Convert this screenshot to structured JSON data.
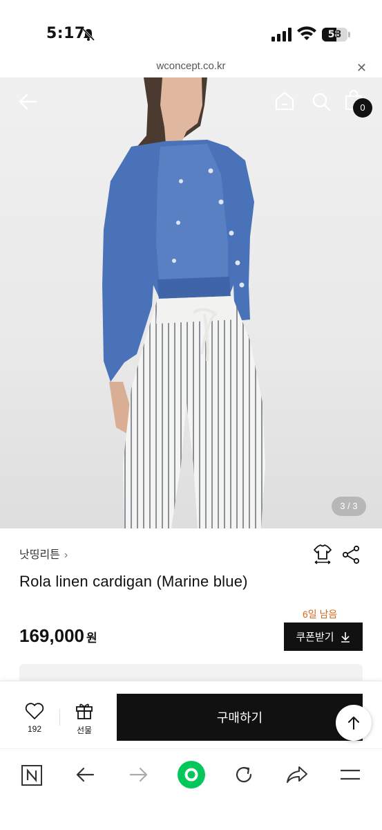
{
  "status_bar": {
    "time": "5:17",
    "battery_level": "58",
    "battery_fraction": 0.58
  },
  "browser": {
    "url": "wconcept.co.kr",
    "close_label": "✕"
  },
  "hero": {
    "cart_count": "0",
    "page_indicator": "3 / 3",
    "icons": [
      "back-arrow-icon",
      "home-icon",
      "search-icon",
      "shopping-bag-icon"
    ]
  },
  "product": {
    "brand": "낫띵리튼",
    "brand_chevron": "›",
    "name": "Rola linen cardigan (Marine blue)",
    "days_left": "6일 남음",
    "price": "169,000",
    "price_unit": "원",
    "coupon_label": "쿠폰받기"
  },
  "action_bar": {
    "like_count": "192",
    "gift_label": "선물",
    "buy_label": "구매하기"
  },
  "browser_toolbar": {
    "icons": [
      "naver-n-icon",
      "back-icon",
      "forward-icon",
      "green-home-icon",
      "refresh-icon",
      "share-icon",
      "menu-icon"
    ],
    "accent": "#03c75a"
  }
}
